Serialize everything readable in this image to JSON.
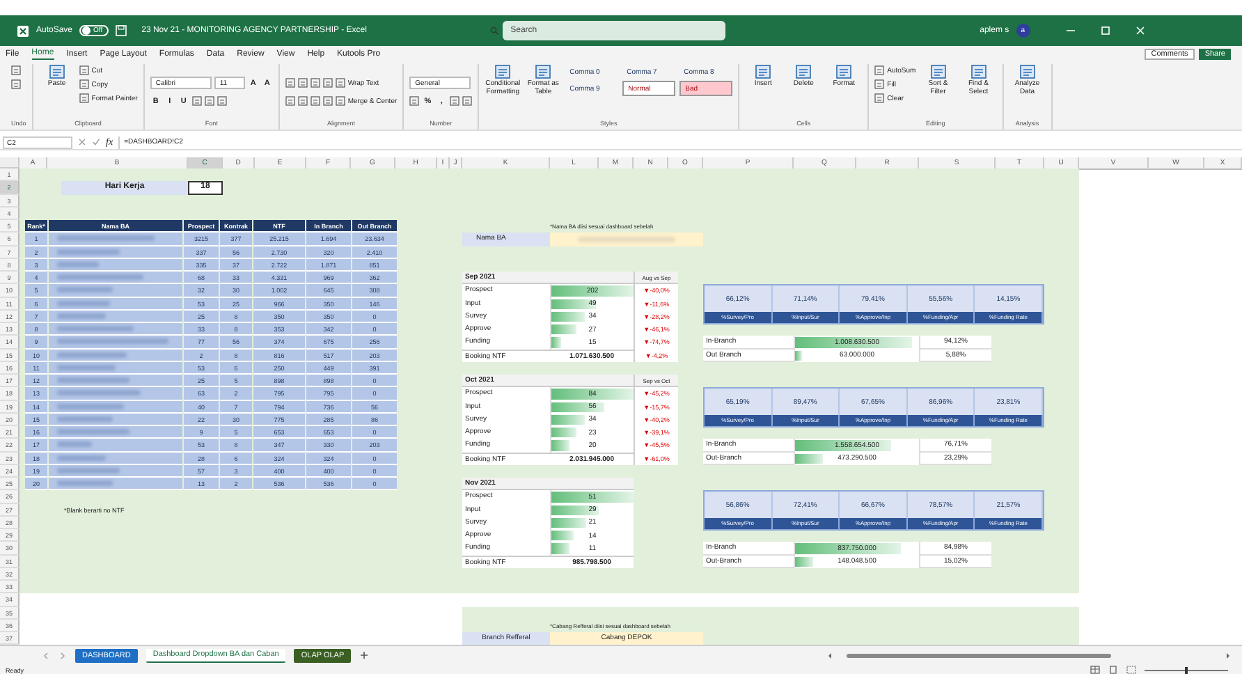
{
  "title_bar": {
    "autosave_label": "AutoSave",
    "autosave_on": false,
    "toggle_text": "Off",
    "title": "23 Nov 21 - MONITORING AGENCY PARTNERSHIP - Excel",
    "search_placeholder": "Search",
    "user": "aplem s",
    "avatar": "a"
  },
  "menu_tabs": [
    {
      "label": "File",
      "selected": false
    },
    {
      "label": "Home",
      "selected": true
    },
    {
      "label": "Insert",
      "selected": false
    },
    {
      "label": "Page Layout",
      "selected": false
    },
    {
      "label": "Formulas",
      "selected": false
    },
    {
      "label": "Data",
      "selected": false
    },
    {
      "label": "Review",
      "selected": false
    },
    {
      "label": "View",
      "selected": false
    },
    {
      "label": "Help",
      "selected": false
    },
    {
      "label": "Kutools Pro",
      "selected": false
    }
  ],
  "comments": "Comments",
  "share": "Share",
  "ribbon": [
    {
      "label": "Undo",
      "kind": "columns",
      "lines": [
        [
          {
            "kind": "icon"
          },
          {
            "kind": "icon"
          }
        ]
      ]
    },
    {
      "label": "Clipboard",
      "kind": "columns",
      "lines": [
        [
          {
            "kind": "big",
            "text": "Paste"
          }
        ],
        [
          {
            "kind": "small",
            "text": "Cut"
          },
          {
            "kind": "small",
            "text": "Copy"
          },
          {
            "kind": "small",
            "text": "Format Painter"
          }
        ]
      ]
    },
    {
      "label": "Font",
      "kind": "rows",
      "lines": [
        [
          {
            "kind": "field",
            "text": "Calibri"
          },
          {
            "kind": "field",
            "text": "11"
          },
          {
            "kind": "tool",
            "text": "A"
          },
          {
            "kind": "tool",
            "text": "A"
          }
        ],
        [
          {
            "kind": "tool",
            "text": "B"
          },
          {
            "kind": "tool",
            "text": "I"
          },
          {
            "kind": "tool",
            "text": "U"
          },
          {
            "kind": "icon"
          },
          {
            "kind": "icon"
          },
          {
            "kind": "icon"
          }
        ]
      ]
    },
    {
      "label": "Alignment",
      "kind": "rows",
      "lines": [
        [
          {
            "kind": "icon"
          },
          {
            "kind": "icon"
          },
          {
            "kind": "icon"
          },
          {
            "kind": "icon"
          },
          {
            "kind": "small",
            "text": "Wrap Text"
          }
        ],
        [
          {
            "kind": "icon"
          },
          {
            "kind": "icon"
          },
          {
            "kind": "icon"
          },
          {
            "kind": "icon"
          },
          {
            "kind": "small",
            "text": "Merge & Center"
          }
        ]
      ]
    },
    {
      "label": "Number",
      "kind": "rows",
      "lines": [
        [
          {
            "kind": "field",
            "text": "General"
          }
        ],
        [
          {
            "kind": "icon"
          },
          {
            "kind": "tool",
            "text": "%"
          },
          {
            "kind": "tool",
            "text": ","
          },
          {
            "kind": "icon"
          },
          {
            "kind": "icon"
          }
        ]
      ]
    },
    {
      "label": "Styles",
      "kind": "columns",
      "lines": [
        [
          {
            "kind": "big",
            "text": "Conditional Formatting"
          }
        ],
        [
          {
            "kind": "big",
            "text": "Format as Table"
          }
        ],
        [
          {
            "kind": "style",
            "text": "Comma 0"
          },
          {
            "kind": "style",
            "text": "Comma 9"
          }
        ],
        [
          {
            "kind": "style",
            "text": "Comma 7"
          },
          {
            "kind": "style",
            "text": "Normal",
            "color": "#ffffff"
          }
        ],
        [
          {
            "kind": "style",
            "text": "Comma 8"
          },
          {
            "kind": "style",
            "text": "Bad",
            "color": "#ffc7ce"
          }
        ]
      ]
    },
    {
      "label": "Cells",
      "kind": "columns",
      "lines": [
        [
          {
            "kind": "big",
            "text": "Insert"
          }
        ],
        [
          {
            "kind": "big",
            "text": "Delete"
          }
        ],
        [
          {
            "kind": "big",
            "text": "Format"
          }
        ]
      ]
    },
    {
      "label": "Editing",
      "kind": "columns",
      "lines": [
        [
          {
            "kind": "small",
            "text": "AutoSum"
          },
          {
            "kind": "small",
            "text": "Fill"
          },
          {
            "kind": "small",
            "text": "Clear"
          }
        ],
        [
          {
            "kind": "big",
            "text": "Sort & Filter"
          }
        ],
        [
          {
            "kind": "big",
            "text": "Find & Select"
          }
        ]
      ]
    },
    {
      "label": "Analysis",
      "kind": "columns",
      "lines": [
        [
          {
            "kind": "big",
            "text": "Analyze Data"
          }
        ]
      ]
    }
  ],
  "formula_bar": {
    "name_box": "C2",
    "fx": "fx",
    "formula": "=DASHBOARD!C2"
  },
  "columns": [
    {
      "label": "A",
      "selected": false
    },
    {
      "label": "B",
      "selected": false
    },
    {
      "label": "C",
      "selected": true
    },
    {
      "label": "D",
      "selected": false
    },
    {
      "label": "E",
      "selected": false
    },
    {
      "label": "F",
      "selected": false
    },
    {
      "label": "G",
      "selected": false
    },
    {
      "label": "H",
      "selected": false
    },
    {
      "label": "I",
      "selected": false
    },
    {
      "label": "J",
      "selected": false
    },
    {
      "label": "K",
      "selected": false
    },
    {
      "label": "L",
      "selected": false
    },
    {
      "label": "M",
      "selected": false
    },
    {
      "label": "N",
      "selected": false
    },
    {
      "label": "O",
      "selected": false
    },
    {
      "label": "P",
      "selected": false
    },
    {
      "label": "Q",
      "selected": false
    },
    {
      "label": "R",
      "selected": false
    },
    {
      "label": "S",
      "selected": false
    },
    {
      "label": "T",
      "selected": false
    },
    {
      "label": "U",
      "selected": false
    },
    {
      "label": "V",
      "selected": false
    },
    {
      "label": "W",
      "selected": false
    },
    {
      "label": "X",
      "selected": false
    }
  ],
  "row_numbers": [
    {
      "label": "1",
      "selected": false
    },
    {
      "label": "2",
      "selected": true
    },
    {
      "label": "3",
      "selected": false
    },
    {
      "label": "4",
      "selected": false
    },
    {
      "label": "5",
      "selected": false
    },
    {
      "label": "6",
      "selected": false
    },
    {
      "label": "7",
      "selected": false
    },
    {
      "label": "8",
      "selected": false
    },
    {
      "label": "9",
      "selected": false
    },
    {
      "label": "10",
      "selected": false
    },
    {
      "label": "11",
      "selected": false
    },
    {
      "label": "12",
      "selected": false
    },
    {
      "label": "13",
      "selected": false
    },
    {
      "label": "14",
      "selected": false
    },
    {
      "label": "15",
      "selected": false
    },
    {
      "label": "16",
      "selected": false
    },
    {
      "label": "17",
      "selected": false
    },
    {
      "label": "18",
      "selected": false
    },
    {
      "label": "19",
      "selected": false
    },
    {
      "label": "20",
      "selected": false
    },
    {
      "label": "21",
      "selected": false
    },
    {
      "label": "22",
      "selected": false
    },
    {
      "label": "23",
      "selected": false
    },
    {
      "label": "24",
      "selected": false
    },
    {
      "label": "25",
      "selected": false
    },
    {
      "label": "26",
      "selected": false
    },
    {
      "label": "27",
      "selected": false
    },
    {
      "label": "28",
      "selected": false
    },
    {
      "label": "29",
      "selected": false
    },
    {
      "label": "30",
      "selected": false
    },
    {
      "label": "31",
      "selected": false
    },
    {
      "label": "32",
      "selected": false
    },
    {
      "label": "33",
      "selected": false
    },
    {
      "label": "34",
      "selected": false
    },
    {
      "label": "35",
      "selected": false
    },
    {
      "label": "36",
      "selected": false
    },
    {
      "label": "37",
      "selected": false
    }
  ],
  "sheet": {
    "hari_kerja": {
      "label": "Hari Kerja",
      "value": "18"
    },
    "ba_table": {
      "columns": [
        "Rank*",
        "Nama BA",
        "Prospect",
        "Kontrak",
        "NTF",
        "In Branch",
        "Out Branch"
      ],
      "rows": [
        {
          "rank": "1",
          "values": [
            "3215",
            "377",
            "25.215",
            "1.694",
            "23.634"
          ]
        },
        {
          "rank": "2",
          "values": [
            "337",
            "56",
            "2.730",
            "320",
            "2.410"
          ]
        },
        {
          "rank": "3",
          "values": [
            "335",
            "37",
            "2.722",
            "1.871",
            "851"
          ]
        },
        {
          "rank": "4",
          "values": [
            "68",
            "33",
            "4.331",
            "969",
            "362"
          ]
        },
        {
          "rank": "5",
          "values": [
            "32",
            "30",
            "1.002",
            "645",
            "308"
          ]
        },
        {
          "rank": "6",
          "values": [
            "53",
            "25",
            "966",
            "350",
            "146"
          ]
        },
        {
          "rank": "7",
          "values": [
            "25",
            "8",
            "350",
            "350",
            "0"
          ]
        },
        {
          "rank": "8",
          "values": [
            "33",
            "8",
            "353",
            "342",
            "0"
          ]
        },
        {
          "rank": "9",
          "values": [
            "77",
            "56",
            "374",
            "675",
            "256"
          ]
        },
        {
          "rank": "10",
          "values": [
            "2",
            "8",
            "816",
            "517",
            "203"
          ]
        },
        {
          "rank": "11",
          "values": [
            "53",
            "6",
            "250",
            "449",
            "391"
          ]
        },
        {
          "rank": "12",
          "values": [
            "25",
            "5",
            "898",
            "898",
            "0"
          ]
        },
        {
          "rank": "13",
          "values": [
            "63",
            "2",
            "795",
            "795",
            "0"
          ]
        },
        {
          "rank": "14",
          "values": [
            "40",
            "7",
            "794",
            "736",
            "56"
          ]
        },
        {
          "rank": "15",
          "values": [
            "22",
            "30",
            "775",
            "285",
            "86"
          ]
        },
        {
          "rank": "16",
          "values": [
            "9",
            "5",
            "653",
            "653",
            "0"
          ]
        },
        {
          "rank": "17",
          "values": [
            "53",
            "8",
            "347",
            "330",
            "203"
          ]
        },
        {
          "rank": "18",
          "values": [
            "28",
            "6",
            "324",
            "324",
            "0"
          ]
        },
        {
          "rank": "19",
          "values": [
            "57",
            "3",
            "400",
            "400",
            "0"
          ]
        },
        {
          "rank": "20",
          "values": [
            "13",
            "2",
            "536",
            "536",
            "0"
          ]
        }
      ]
    },
    "note": "*Blank berarti no NTF",
    "ba_selector": {
      "note": "*Nama BA diisi sesuai dashboard sebelah",
      "label": "Nama BA"
    },
    "months": [
      {
        "title": "Sep 2021",
        "compare_label": "Aug vs Sep",
        "metrics": [
          {
            "label": "Prospect",
            "value": "202",
            "level": 1,
            "change": "▼-40,0%"
          },
          {
            "label": "Input",
            "value": "49",
            "level": 0.55,
            "change": "▼-11,6%"
          },
          {
            "label": "Survey",
            "value": "34",
            "level": 0.4,
            "change": "▼-28,2%"
          },
          {
            "label": "Approve",
            "value": "27",
            "level": 0.3,
            "change": "▼-46,1%"
          },
          {
            "label": "Funding",
            "value": "15",
            "level": 0.12,
            "change": "▼-74,7%"
          }
        ],
        "booking": {
          "label": "Booking NTF",
          "value": "1.071.630.500",
          "change": "▼-4,2%"
        },
        "ratios": [
          {
            "value": "66,12%",
            "label": "%Survey/Pro"
          },
          {
            "value": "71,14%",
            "label": "%Input/Sur"
          },
          {
            "value": "79,41%",
            "label": "%Approve/Inp"
          },
          {
            "value": "55,56%",
            "label": "%Funding/Apr"
          },
          {
            "value": "14,15%",
            "label": "%Funding Rate"
          }
        ],
        "branches": [
          {
            "label": "In-Branch",
            "value": "1.008.630.500",
            "level": 0.94,
            "share": "94,12%"
          },
          {
            "label": "Out Branch",
            "value": "63.000.000",
            "level": 0.06,
            "share": "5,88%"
          }
        ]
      },
      {
        "title": "Oct 2021",
        "compare_label": "Sep vs Oct",
        "metrics": [
          {
            "label": "Prospect",
            "value": "84",
            "level": 1,
            "change": "▼-45,2%"
          },
          {
            "label": "Input",
            "value": "56",
            "level": 0.65,
            "change": "▼-15,7%"
          },
          {
            "label": "Survey",
            "value": "34",
            "level": 0.4,
            "change": "▼-40,2%"
          },
          {
            "label": "Approve",
            "value": "23",
            "level": 0.3,
            "change": "▼-39,1%"
          },
          {
            "label": "Funding",
            "value": "20",
            "level": 0.22,
            "change": "▼-45,5%"
          }
        ],
        "booking": {
          "label": "Booking NTF",
          "value": "2.031.945.000",
          "change": "▼-61,0%"
        },
        "ratios": [
          {
            "value": "65,19%",
            "label": "%Survey/Pro"
          },
          {
            "value": "89,47%",
            "label": "%Input/Sur"
          },
          {
            "value": "67,65%",
            "label": "%Approve/Inp"
          },
          {
            "value": "86,96%",
            "label": "%Funding/Apr"
          },
          {
            "value": "23,81%",
            "label": "%Funding Rate"
          }
        ],
        "branches": [
          {
            "label": "In-Branch",
            "value": "1.558.654.500",
            "level": 0.77,
            "share": "76,71%"
          },
          {
            "label": "Out-Branch",
            "value": "473.290.500",
            "level": 0.23,
            "share": "23,29%"
          }
        ]
      },
      {
        "title": "Nov 2021",
        "metrics": [
          {
            "label": "Prospect",
            "value": "51",
            "level": 1
          },
          {
            "label": "Input",
            "value": "29",
            "level": 0.57
          },
          {
            "label": "Survey",
            "value": "21",
            "level": 0.42
          },
          {
            "label": "Approve",
            "value": "14",
            "level": 0.27
          },
          {
            "label": "Funding",
            "value": "11",
            "level": 0.22
          }
        ],
        "booking": {
          "label": "Booking NTF",
          "value": "985.798.500"
        },
        "ratios": [
          {
            "value": "56,86%",
            "label": "%Survey/Pro"
          },
          {
            "value": "72,41%",
            "label": "%Input/Sur"
          },
          {
            "value": "66,67%",
            "label": "%Approve/Inp"
          },
          {
            "value": "78,57%",
            "label": "%Funding/Apr"
          },
          {
            "value": "21,57%",
            "label": "%Funding Rate"
          }
        ],
        "branches": [
          {
            "label": "In-Branch",
            "value": "837.750.000",
            "level": 0.85,
            "share": "84,98%"
          },
          {
            "label": "Out-Branch",
            "value": "148.048.500",
            "level": 0.15,
            "share": "15,02%"
          }
        ]
      }
    ],
    "branch_selector": {
      "note": "*Cabang Refferal diisi sesuai dashboard sebelah",
      "label": "Branch Refferal",
      "value": "Cabang DEPOK"
    }
  },
  "sheet_tabs": [
    {
      "label": "DASHBOARD",
      "color": "#1f6fc4",
      "selected": false
    },
    {
      "label": "Dashboard Dropdown BA dan Caban",
      "selected": true
    },
    {
      "label": "OLAP OLAP",
      "color": "#3a5f22",
      "selected": false
    }
  ],
  "status": "Ready",
  "zoom": {
    "level": 0.5
  }
}
